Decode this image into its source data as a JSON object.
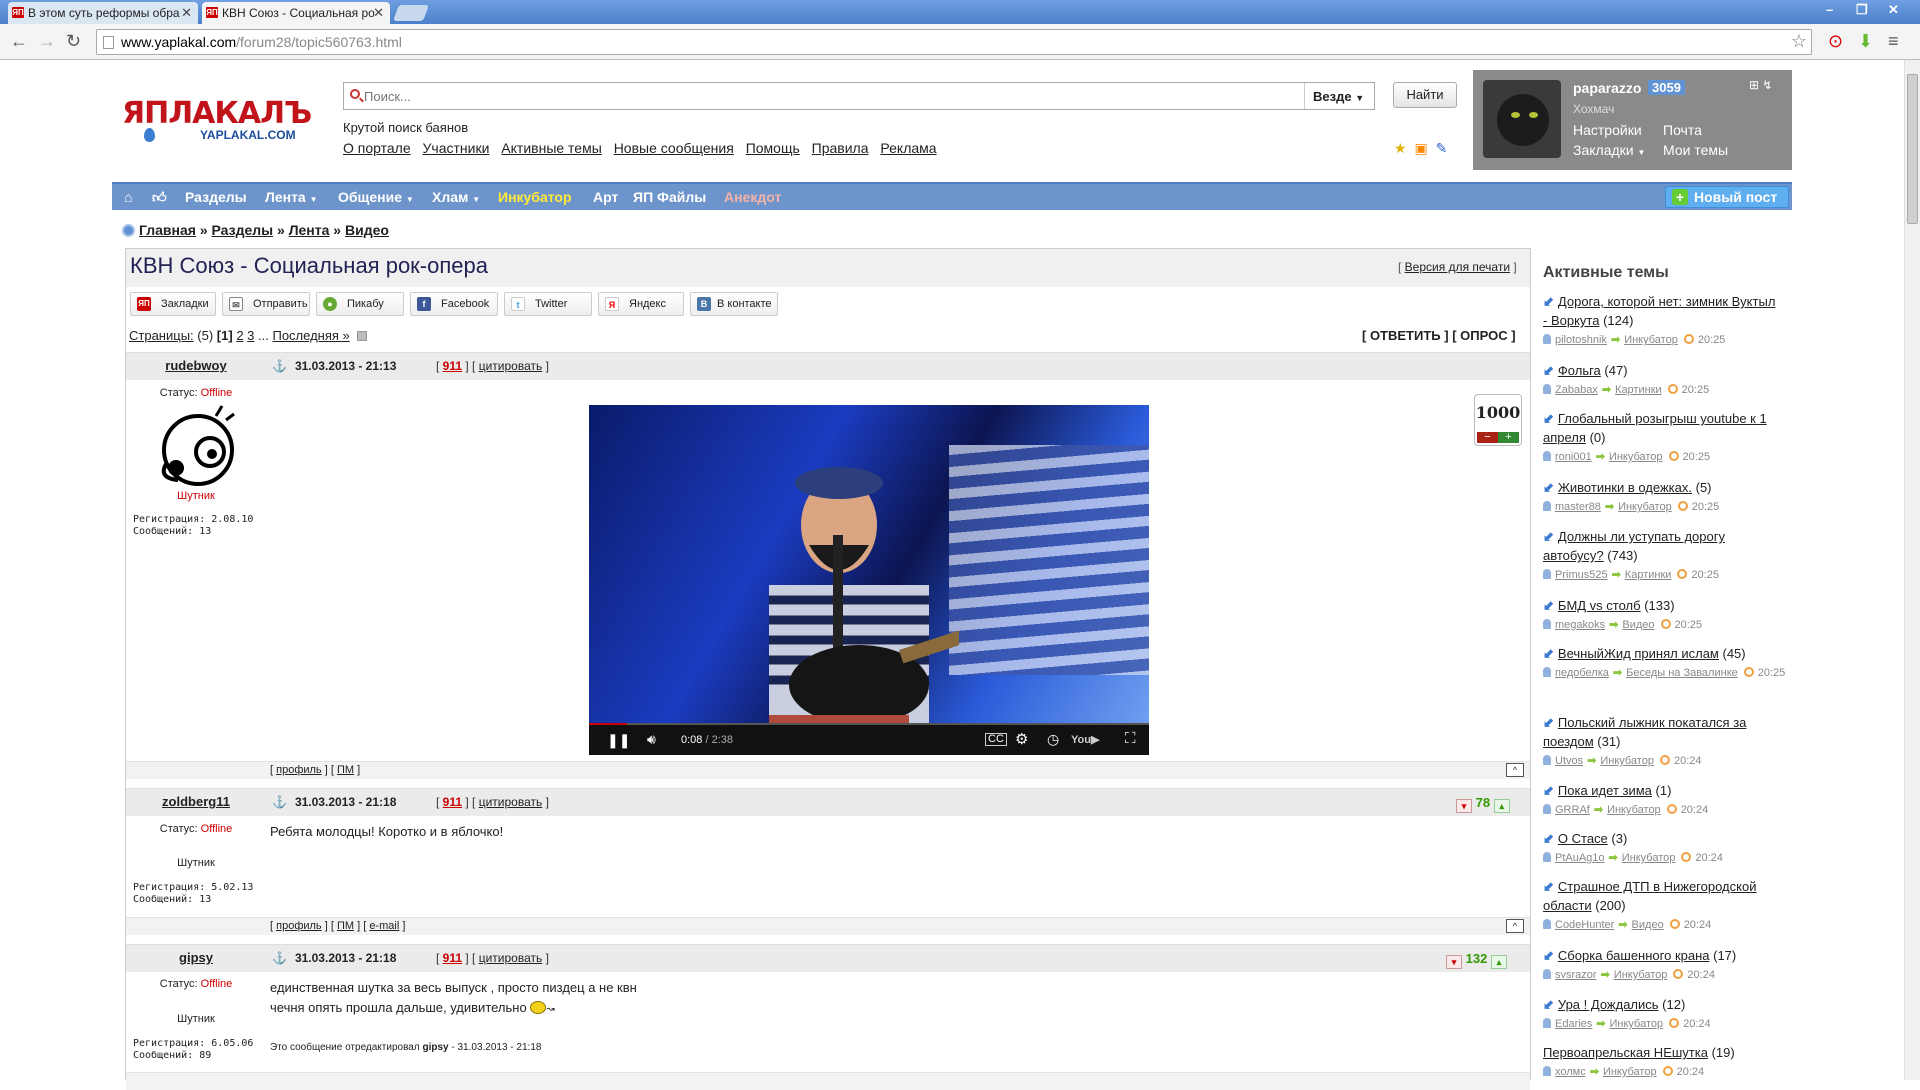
{
  "browser": {
    "tabs": [
      {
        "label": "В этом суть реформы обра",
        "favicon": "ЯП"
      },
      {
        "label": "КВН Союз - Социальная ро",
        "favicon": "ЯП"
      }
    ],
    "url_host": "www.yaplakal.com",
    "url_path": "/forum28/topic560763.html"
  },
  "header": {
    "logo_main": "ЯПЛАКАЛЪ",
    "logo_sub": "YAPLAKAL.COM",
    "search_placeholder": "Поиск...",
    "search_scope": "Везде",
    "search_button": "Найти",
    "tagline": "Крутой поиск баянов",
    "links": [
      "О портале",
      "Участники",
      "Активные темы",
      "Новые сообщения",
      "Помощь",
      "Правила",
      "Реклама"
    ]
  },
  "user": {
    "name": "paparazzo",
    "score": "3059",
    "rank": "Хохмач",
    "menu": {
      "settings": "Настройки",
      "mail": "Почта",
      "bookmarks": "Закладки",
      "mytopics": "Мои темы"
    }
  },
  "nav": {
    "items": [
      "Разделы",
      "Лента",
      "Общение",
      "Хлам",
      "Инкубатор",
      "Арт",
      "ЯП Файлы",
      "Анекдот"
    ],
    "new_post": "Новый пост"
  },
  "breadcrumb": [
    "Главная",
    "Разделы",
    "Лента",
    "Видео"
  ],
  "topic": {
    "title": "КВН Союз - Социальная рок-опера",
    "print_version": "Версия для печати",
    "share": [
      "Закладки",
      "Отправить",
      "Пикабу",
      "Facebook",
      "Twitter",
      "Яндекс",
      "В контакте"
    ],
    "pages_label": "Страницы:",
    "pages_count": "(5)",
    "current_page": "[1]",
    "pages": [
      "2",
      "3"
    ],
    "last_page": "Последняя »",
    "reply": "[ ОТВЕТИТЬ ]",
    "poll": "[ ОПРОС ]"
  },
  "posts": [
    {
      "nick": "rudebwoy",
      "date": "31.03.2013 - 21:13",
      "num": "911",
      "quote": "цитировать",
      "status_label": "Статус:",
      "status": "Offline",
      "rank": "Шутник",
      "reg": "Регистрация: 2.08.10",
      "msgs": "Сообщений: 13",
      "rating": "1000",
      "video_time": "0:08",
      "video_duration": "/ 2:38",
      "footer_links": [
        "профиль",
        "ПМ"
      ]
    },
    {
      "nick": "zoldberg11",
      "date": "31.03.2013 - 21:18",
      "num": "911",
      "quote": "цитировать",
      "status_label": "Статус:",
      "status": "Offline",
      "rank": "Шутник",
      "reg": "Регистрация: 5.02.13",
      "msgs": "Сообщений: 13",
      "rating": "78",
      "text": "Ребята молодцы! Коротко и в яблочко!",
      "footer_links": [
        "профиль",
        "ПМ",
        "e-mail"
      ]
    },
    {
      "nick": "gipsy",
      "date": "31.03.2013 - 21:18",
      "num": "911",
      "quote": "цитировать",
      "status_label": "Статус:",
      "status": "Offline",
      "rank": "Шутник",
      "reg": "Регистрация: 6.05.06",
      "msgs": "Сообщений: 89",
      "rating": "132",
      "text1": "единственная шутка за весь выпуск , просто пиздец а не квн",
      "text2": "чечня опять прошла дальше, удивительно",
      "edited": "Это сообщение отредактировал",
      "edited_by": "gipsy",
      "edited_at": "- 31.03.2013 - 21:18",
      "footer_links": [
        "профиль",
        "ПМ",
        "e-mail"
      ]
    }
  ],
  "sidebar": {
    "title": "Активные темы",
    "items": [
      {
        "title": "Дорога, которой нет: зимник Вуктыл - Воркута",
        "count": "(124)",
        "author": "pilotoshnik",
        "section": "Инкубатор",
        "time": "20:25"
      },
      {
        "title": "Фольга",
        "count": "(47)",
        "author": "Zababax",
        "section": "Картинки",
        "time": "20:25"
      },
      {
        "title": "Глобальный розыгрыш youtube к 1 апреля",
        "count": "(0)",
        "author": "roni001",
        "section": "Инкубатор",
        "time": "20:25"
      },
      {
        "title": "Животинки в одежках.",
        "count": "(5)",
        "author": "master88",
        "section": "Инкубатор",
        "time": "20:25"
      },
      {
        "title": "Должны ли уступать дорогу автобусу?",
        "count": "(743)",
        "author": "Primus525",
        "section": "Картинки",
        "time": "20:25"
      },
      {
        "title": "БМД vs столб",
        "count": "(133)",
        "author": "megakoks",
        "section": "Видео",
        "time": "20:25"
      },
      {
        "title": "ВечныйЖид принял ислам",
        "count": "(45)",
        "author": "педобелка",
        "section": "Беседы на Завалинке",
        "time": "20:25"
      },
      {
        "title": "Польский лыжник покатался за поездом",
        "count": "(31)",
        "author": "Utvos",
        "section": "Инкубатор",
        "time": "20:24"
      },
      {
        "title": "Пока идет зима",
        "count": "(1)",
        "author": "GRRAf",
        "section": "Инкубатор",
        "time": "20:24"
      },
      {
        "title": "О Стасе",
        "count": "(3)",
        "author": "PtAuAg1o",
        "section": "Инкубатор",
        "time": "20:24"
      },
      {
        "title": "Страшное ДТП в Нижегородской области",
        "count": "(200)",
        "author": "CodeHunter",
        "section": "Видео",
        "time": "20:24"
      },
      {
        "title": "Сборка башенного крана",
        "count": "(17)",
        "author": "svsrazor",
        "section": "Инкубатор",
        "time": "20:24"
      },
      {
        "title": "Ура ! Дождались",
        "count": "(12)",
        "author": "Edaries",
        "section": "Инкубатор",
        "time": "20:24"
      },
      {
        "title": "Первоапрельская НЕшутка",
        "count": "(19)",
        "author": "холмс",
        "section": "Инкубатор",
        "time": "20:24"
      }
    ]
  }
}
